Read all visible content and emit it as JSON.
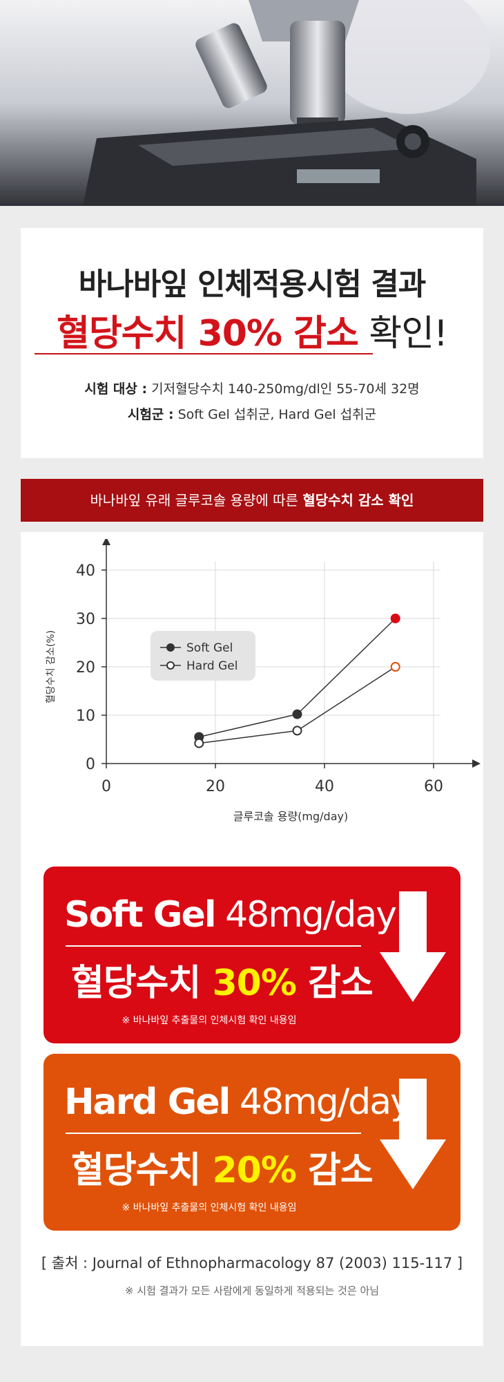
{
  "header": {
    "title_line1": "바나바잎 인체적용시험 결과",
    "title_highlight": "혈당수치 30% 감소",
    "title_suffix": " 확인!",
    "subject_label": "시험 대상 :",
    "subject_text": " 기저혈당수치 140-250mg/dl인 55-70세 32명",
    "group_label": "시험군 :",
    "group_text": " Soft Gel 섭취군, Hard Gel 섭취군"
  },
  "banner": {
    "text_plain": "바나바잎 유래 글루코솔 용량에 따른 ",
    "text_bold": "혈당수치 감소 확인"
  },
  "chart_data": {
    "type": "line",
    "xlabel": "글루코솔 용량(mg/day)",
    "ylabel": "혈당수치 감소(%)",
    "xlim": [
      0,
      60
    ],
    "ylim": [
      0,
      40
    ],
    "xticks": [
      "0",
      "20",
      "40",
      "60"
    ],
    "yticks": [
      "0",
      "10",
      "20",
      "30",
      "40"
    ],
    "grid": true,
    "legend_position": "left",
    "series": [
      {
        "name": "Soft Gel",
        "marker": "filled",
        "points": [
          [
            17,
            5.5
          ],
          [
            35,
            10.2
          ],
          [
            53,
            30
          ]
        ]
      },
      {
        "name": "Hard Gel",
        "marker": "hollow",
        "points": [
          [
            17,
            4.2
          ],
          [
            35,
            6.8
          ],
          [
            53,
            20
          ]
        ]
      }
    ]
  },
  "callouts": [
    {
      "product": "Soft Gel",
      "dose": " 48mg/day",
      "prefix": "혈당수치 ",
      "value": "30% ",
      "suffix": "감소",
      "note": "※ 바나바잎 추출물의 인체시험 확인 내용임",
      "color": "#d90a14"
    },
    {
      "product": "Hard Gel",
      "dose": " 48mg/day",
      "prefix": "혈당수치 ",
      "value": "20% ",
      "suffix": "감소",
      "note": "※ 바나바잎 추출물의 인체시험 확인 내용임",
      "color": "#e0520a"
    }
  ],
  "source": "[ 출처 : Journal of Ethnopharmacology 87 (2003) 115-117 ]",
  "disclaimer": "※ 시험 결과가 모든 사람에게 동일하게 적용되는 것은 아님",
  "colors": {
    "accent_red": "#d3131a",
    "banner": "#a70f12",
    "soft_gel": "#d90a14",
    "hard_gel": "#e0520a",
    "highlight_yellow": "#fff200"
  }
}
